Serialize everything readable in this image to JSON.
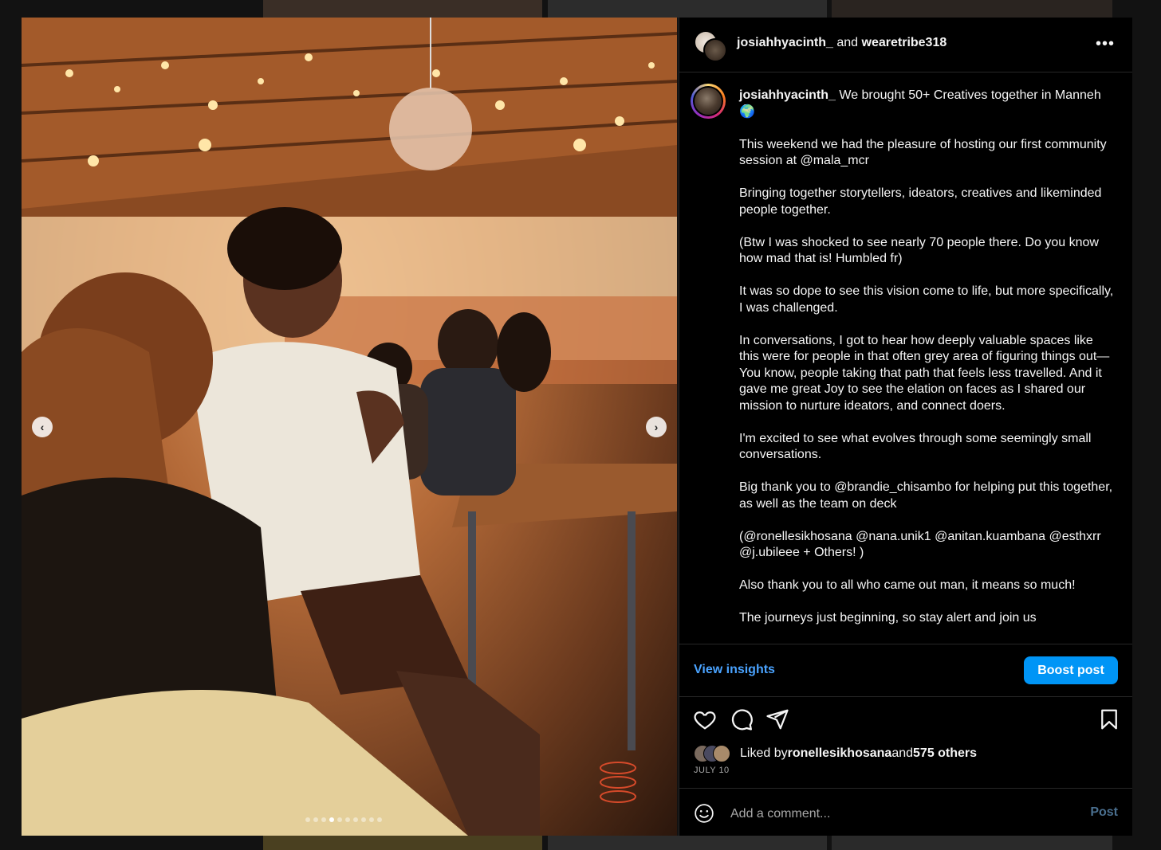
{
  "header": {
    "user1": "josiahhyacinth_",
    "joiner": " and ",
    "user2": "wearetribe318",
    "more_icon": "more-horizontal-icon"
  },
  "caption": {
    "username": "josiahhyacinth_",
    "paragraphs": [
      "We brought 50+ Creatives together in Manneh 🌍",
      "This weekend we had the pleasure of hosting our first community session at @mala_mcr",
      "Bringing together storytellers, ideators, creatives and likeminded people together.",
      "(Btw I was shocked to see nearly 70 people there. Do you know how mad that is! Humbled fr)",
      "It was so dope to see this vision come to life, but more specifically, I was challenged.",
      "In conversations, I got to hear how deeply valuable spaces like this were for people in that often grey area of figuring things out— You know, people taking that path that feels less travelled. And it gave me great Joy to see the elation on faces as I shared our mission to nurture ideators, and connect doers.",
      "I'm excited to see what evolves through some seemingly small conversations.",
      "Big thank you to @brandie_chisambo for helping put this together, as well as the team on deck",
      "(@ronellesikhosana @nana.unik1 @anitan.kuambana @esthxrr @j.ubileee + Others! )",
      "Also thank you to all who came out man, it means so much!",
      "The journeys just beginning, so stay alert and join us"
    ]
  },
  "insights": {
    "view_label": "View insights",
    "boost_label": "Boost post"
  },
  "likes": {
    "prefix": "Liked by ",
    "user": "ronellesikhosana",
    "middle": " and ",
    "others": "575 others"
  },
  "date": "JULY 10",
  "comment": {
    "placeholder": "Add a comment...",
    "post_label": "Post"
  },
  "carousel": {
    "prev_icon": "chevron-left-icon",
    "next_icon": "chevron-right-icon",
    "total": 10,
    "active_index": 3
  },
  "colors": {
    "accent": "#0095f6",
    "link": "#4aa3ff",
    "panel_bg": "#000000"
  }
}
